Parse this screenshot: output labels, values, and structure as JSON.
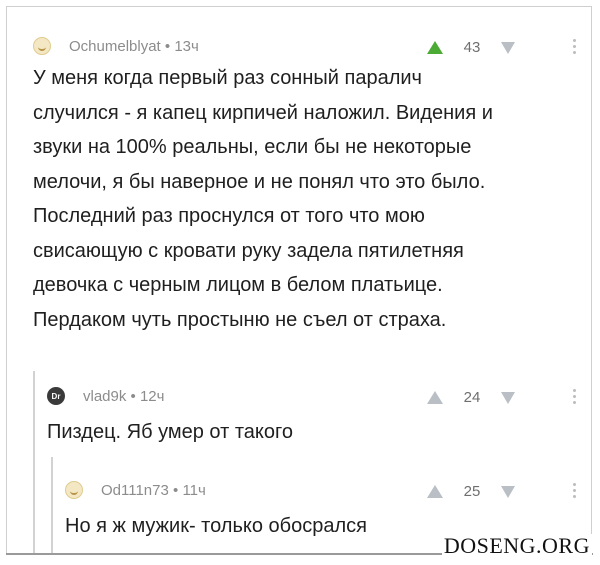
{
  "comments": [
    {
      "author": "Ochumelblyat",
      "time": "13ч",
      "score": "43",
      "avatar_icon": "sleeping-face-icon",
      "upvoted": true,
      "text": "У меня когда первый раз сонный паралич\nслучился - я капец кирпичей наложил. Видения и\nзвуки на 100% реальны, если бы не некоторые\nмелочи, я бы наверное и не понял что это было.\nПоследний раз проснулся от того что мою\nсвисающую с кровати руку задела пятилетняя\nдевочка с черным лицом в белом платьице.\nПердаком чуть простыню не съел от страха."
    },
    {
      "author": "vlad9k",
      "time": "12ч",
      "score": "24",
      "avatar_icon": "dr-badge-icon",
      "avatar_text": "Dr",
      "upvoted": false,
      "text": "Пиздец. Яб умер от такого"
    },
    {
      "author": "Od111n73",
      "time": "11ч",
      "score": "25",
      "avatar_icon": "sleeping-face-icon",
      "upvoted": false,
      "text": "Но я ж мужик- только обосрался"
    }
  ],
  "meta_separator": "•",
  "watermark": "DOSENG.ORG",
  "colors": {
    "upvote_active": "#4cab35",
    "vote_inactive": "#b9bfc4",
    "meta_text": "#8c8c8c",
    "body_text": "#1f1f1f",
    "thread_line": "#d2d2d2"
  }
}
